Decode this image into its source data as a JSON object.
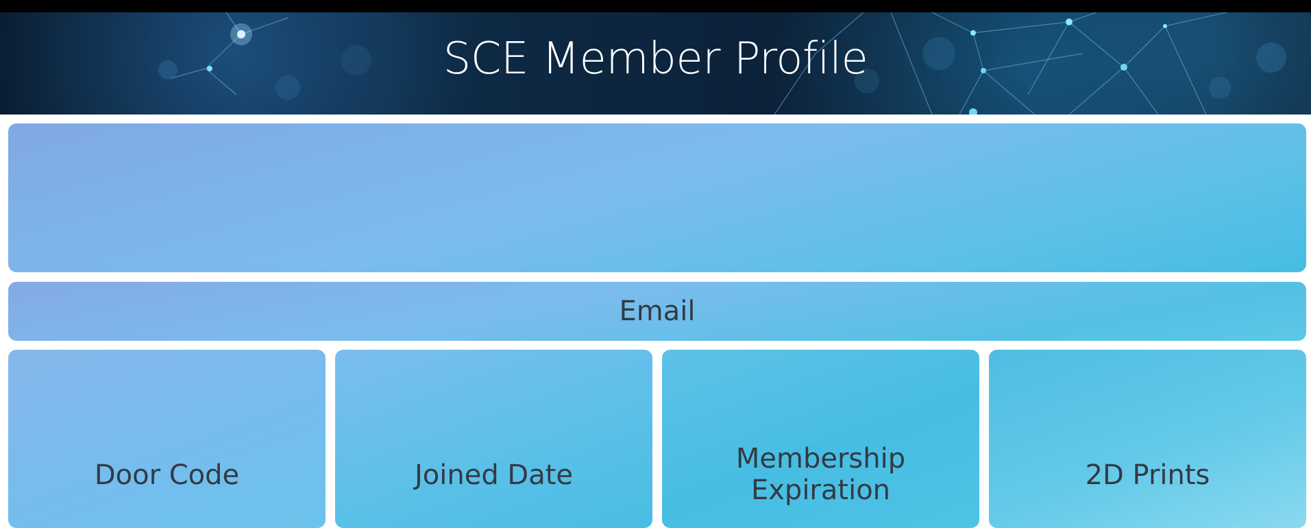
{
  "header": {
    "title": "SCE Member Profile"
  },
  "banner": {
    "text": ""
  },
  "email": {
    "label": "Email"
  },
  "stats": [
    {
      "label": "Door Code"
    },
    {
      "label": "Joined Date"
    },
    {
      "label_line1": "Membership",
      "label_line2": "Expiration"
    },
    {
      "label": "2D Prints"
    }
  ],
  "colors": {
    "header_bg": "#0c2138",
    "card_gradient_start": "#82a9e6",
    "card_gradient_end": "#4cbfe4",
    "card_text": "#333a44"
  }
}
